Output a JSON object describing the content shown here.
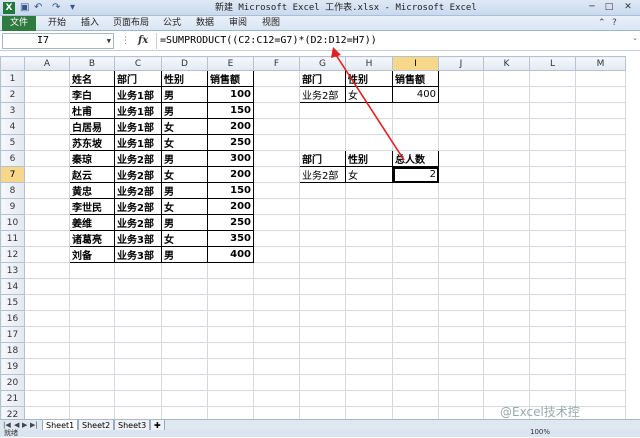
{
  "titlebar": {
    "logo": "X",
    "title": "新建 Microsoft Excel 工作表.xlsx - Microsoft Excel",
    "save_icon": "save-icon",
    "undo_icon": "undo-icon",
    "redo_icon": "redo-icon"
  },
  "ribbon": {
    "tabs": [
      "文件",
      "开始",
      "插入",
      "页面布局",
      "公式",
      "数据",
      "审阅",
      "视图"
    ]
  },
  "formula_bar": {
    "name_box": "I7",
    "fx": "fx",
    "formula": "=SUMPRODUCT((C2:C12=G7)*(D2:D12=H7))"
  },
  "columns": [
    "A",
    "B",
    "C",
    "D",
    "E",
    "F",
    "G",
    "H",
    "I",
    "J",
    "K",
    "L",
    "M"
  ],
  "rows": [
    "1",
    "2",
    "3",
    "4",
    "5",
    "6",
    "7",
    "8",
    "9",
    "10",
    "11",
    "12",
    "13",
    "14",
    "15",
    "16",
    "17",
    "18",
    "19",
    "20",
    "21",
    "22"
  ],
  "table": {
    "headers": [
      "姓名",
      "部门",
      "性别",
      "销售额"
    ],
    "rows": [
      [
        "李白",
        "业务1部",
        "男",
        "100"
      ],
      [
        "杜甫",
        "业务1部",
        "男",
        "150"
      ],
      [
        "白居易",
        "业务1部",
        "女",
        "200"
      ],
      [
        "苏东坡",
        "业务1部",
        "女",
        "250"
      ],
      [
        "秦琼",
        "业务2部",
        "男",
        "300"
      ],
      [
        "赵云",
        "业务2部",
        "女",
        "200"
      ],
      [
        "黄忠",
        "业务2部",
        "男",
        "150"
      ],
      [
        "李世民",
        "业务2部",
        "女",
        "200"
      ],
      [
        "姜维",
        "业务2部",
        "男",
        "250"
      ],
      [
        "诸葛亮",
        "业务3部",
        "女",
        "350"
      ],
      [
        "刘备",
        "业务3部",
        "男",
        "400"
      ]
    ]
  },
  "lookup1": {
    "headers": [
      "部门",
      "性别",
      "销售额"
    ],
    "values": [
      "业务2部",
      "女",
      "400"
    ]
  },
  "lookup2": {
    "headers": [
      "部门",
      "性别",
      "总人数"
    ],
    "values": [
      "业务2部",
      "女",
      "2"
    ]
  },
  "sheets": [
    "Sheet1",
    "Sheet2",
    "Sheet3"
  ],
  "status": "就绪",
  "zoom": "100%",
  "watermark": "@Excel技术控"
}
